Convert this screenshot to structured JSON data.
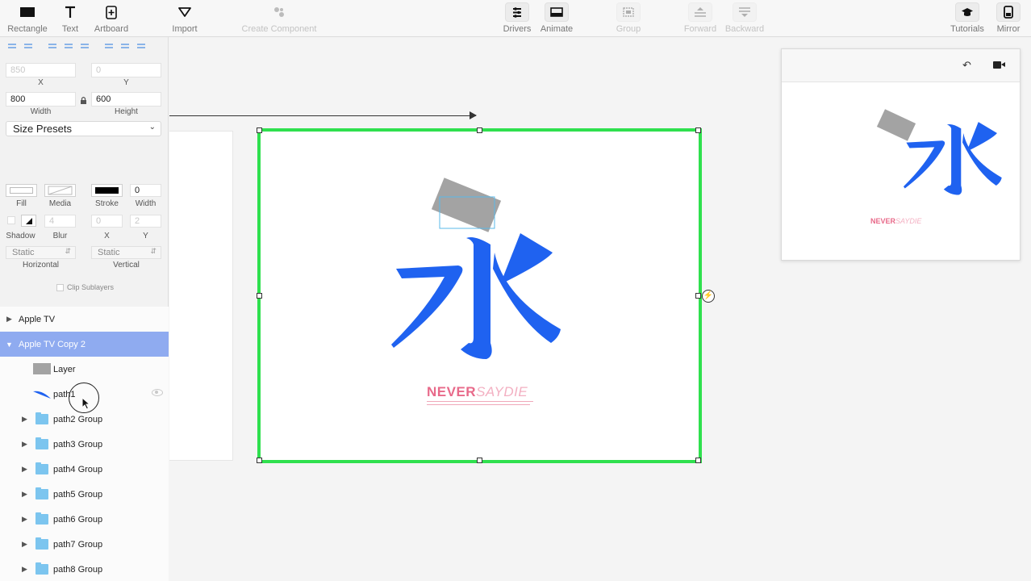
{
  "toolbar": {
    "rectangle": "Rectangle",
    "text": "Text",
    "artboard": "Artboard",
    "import": "Import",
    "create_component": "Create Component",
    "drivers": "Drivers",
    "animate": "Animate",
    "group": "Group",
    "forward": "Forward",
    "backward": "Backward",
    "tutorials": "Tutorials",
    "mirror": "Mirror"
  },
  "inspector": {
    "x_value": "850",
    "y_value": "0",
    "x_label": "X",
    "y_label": "Y",
    "width_value": "800",
    "height_value": "600",
    "width_label": "Width",
    "height_label": "Height",
    "size_presets": "Size Presets",
    "fill_label": "Fill",
    "media_label": "Media",
    "stroke_label": "Stroke",
    "stroke_width_value": "0",
    "stroke_width_label": "Width",
    "shadow_label": "Shadow",
    "blur_value": "4",
    "blur_label": "Blur",
    "shadow_x_value": "0",
    "shadow_x_label": "X",
    "shadow_y_value": "2",
    "shadow_y_label": "Y",
    "horizontal_value": "Static",
    "horizontal_label": "Horizontal",
    "vertical_value": "Static",
    "vertical_label": "Vertical",
    "clip_sublayers": "Clip Sublayers"
  },
  "layers": {
    "items": [
      {
        "label": "Apple TV"
      },
      {
        "label": "Apple TV Copy 2"
      },
      {
        "label": "Layer"
      },
      {
        "label": "path1"
      },
      {
        "label": "path2 Group"
      },
      {
        "label": "path3 Group"
      },
      {
        "label": "path4 Group"
      },
      {
        "label": "path5 Group"
      },
      {
        "label": "path6 Group"
      },
      {
        "label": "path7 Group"
      },
      {
        "label": "path8 Group"
      }
    ]
  },
  "canvas": {
    "glyph": "永",
    "brand_a": "NEVER",
    "brand_b": "SAYDIE"
  },
  "colors": {
    "selection_green": "#2fe04e",
    "glyph_blue": "#1f62f0",
    "brand_pink": "#e86a8a",
    "layer_selected": "#8fabf0",
    "folder_blue": "#7cc5ef"
  },
  "icons": {
    "undo": "undo-icon",
    "camera": "video-camera-icon"
  }
}
